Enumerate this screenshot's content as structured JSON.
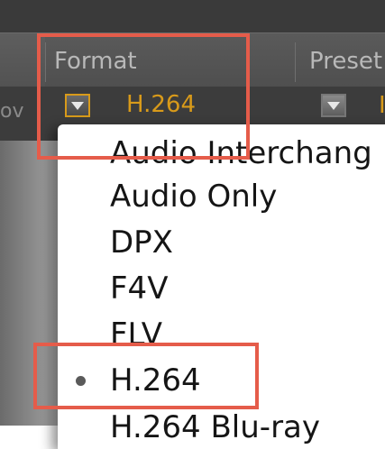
{
  "table": {
    "columns": [
      {
        "label": "Format"
      },
      {
        "label": "Preset"
      }
    ],
    "row": {
      "left_edge_text": "ov",
      "format_value": "H.264",
      "preset_value_partial": "I"
    }
  },
  "menu": {
    "items": [
      {
        "label": "Audio Interchang"
      },
      {
        "label": "Audio Only"
      },
      {
        "label": "DPX"
      },
      {
        "label": "F4V"
      },
      {
        "label": "FLV"
      },
      {
        "label": "H.264"
      },
      {
        "label": "H.264 Blu-ray"
      }
    ],
    "selected_index": 5
  },
  "colors": {
    "accent": "#d89a1a",
    "annotation": "#e55c4a",
    "header_bg": "#555555",
    "row_bg": "#3c3c3c"
  }
}
